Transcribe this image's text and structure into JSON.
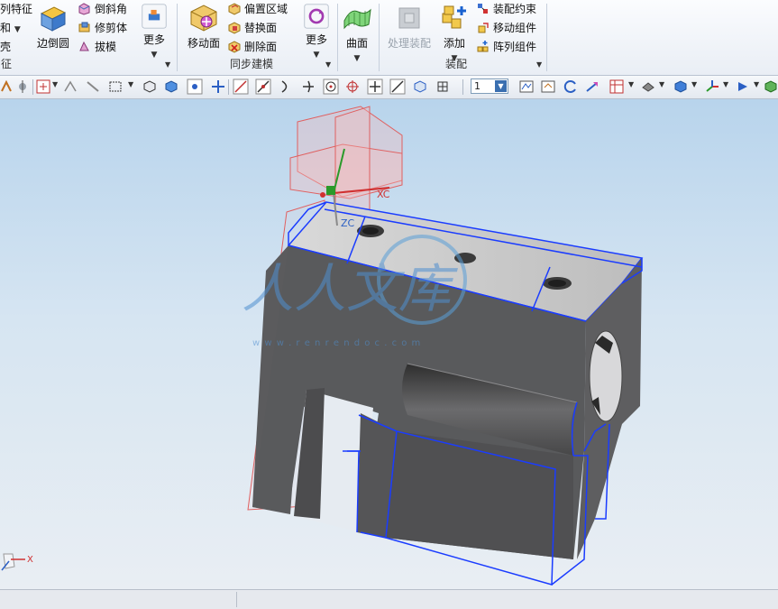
{
  "ribbon": {
    "partial_left": {
      "item1": "列特征",
      "item2": "和",
      "item3": "壳",
      "group_label": "征"
    },
    "edge_blend": {
      "label": "边倒圆"
    },
    "small_col1": {
      "chamfer": "倒斜角",
      "trim_body": "修剪体",
      "draft": "拔模"
    },
    "more1": {
      "label": "更多"
    },
    "move_face": {
      "label": "移动面"
    },
    "sync_col": {
      "offset_region": "偏置区域",
      "replace_face": "替换面",
      "delete_face": "删除面"
    },
    "more2": {
      "label": "更多"
    },
    "sync_group_label": "同步建模",
    "surface": {
      "label": "曲面"
    },
    "process_assembly": {
      "label": "处理装配"
    },
    "add": {
      "label": "添加"
    },
    "assembly_col": {
      "constraint": "装配约束",
      "move_component": "移动组件",
      "array_component": "阵列组件"
    },
    "assembly_group_label": "装配"
  },
  "toolbar": {
    "layer_value": "1",
    "layer_dropdown_icon": "chevron-down-icon"
  },
  "viewport": {
    "axis_xc": "XC",
    "axis_zc": "ZC",
    "triad_x": "X",
    "watermark_text": "人人文库",
    "watermark_url": "w w w . r e n r e n d o c . c o m"
  },
  "colors": {
    "model_gray": "#5a5a5c",
    "edge_blue": "#1a3cff",
    "datum_red": "#e06060",
    "ribbon_bg": "#eef2f7"
  }
}
